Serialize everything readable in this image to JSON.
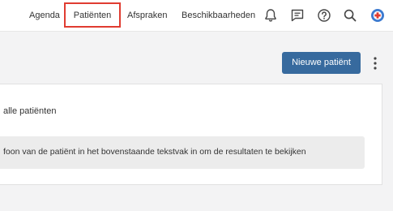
{
  "nav": {
    "items": [
      {
        "label": "Agenda"
      },
      {
        "label": "Patiënten",
        "active": true
      },
      {
        "label": "Afspraken"
      },
      {
        "label": "Beschikbaarheden"
      }
    ],
    "icons": [
      "bell-icon",
      "chat-icon",
      "help-icon",
      "search-icon",
      "logo-icon"
    ]
  },
  "toolbar": {
    "new_patient_label": "Nieuwe patiënt",
    "more_icon": "more-vertical-icon"
  },
  "content": {
    "title": "alle patiënten",
    "info": "foon van de patiënt in het bovenstaande tekstvak in om de resultaten te bekijken"
  },
  "colors": {
    "accent": "#376a9e",
    "highlight": "#e03c31"
  }
}
